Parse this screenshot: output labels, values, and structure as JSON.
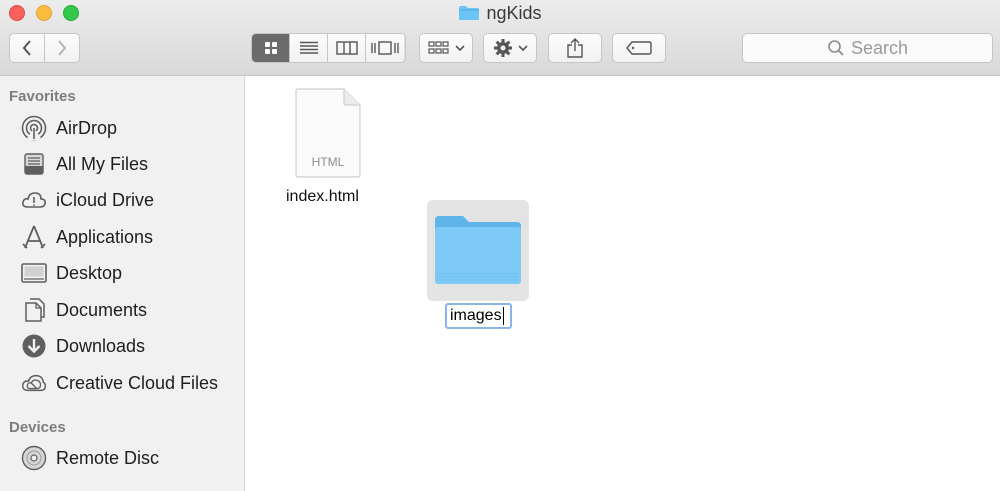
{
  "window": {
    "title": "ngKids"
  },
  "toolbar": {
    "back_icon": "chevron-left-icon",
    "forward_icon": "chevron-right-icon",
    "view_modes": [
      "icon-view-icon",
      "list-view-icon",
      "column-view-icon",
      "cover-flow-icon"
    ],
    "active_view": "icon-view-icon",
    "arrange_icon": "arrange-icon",
    "action_icon": "gear-icon",
    "share_icon": "share-icon",
    "tag_icon": "tag-icon",
    "search_placeholder": "Search"
  },
  "sidebar": {
    "favorites_header": "Favorites",
    "favorites": [
      {
        "label": "AirDrop",
        "icon": "airdrop-icon"
      },
      {
        "label": "All My Files",
        "icon": "all-files-icon"
      },
      {
        "label": "iCloud Drive",
        "icon": "cloud-icon"
      },
      {
        "label": "Applications",
        "icon": "applications-icon"
      },
      {
        "label": "Desktop",
        "icon": "desktop-icon"
      },
      {
        "label": "Documents",
        "icon": "documents-icon"
      },
      {
        "label": "Downloads",
        "icon": "downloads-icon"
      },
      {
        "label": "Creative Cloud Files",
        "icon": "creative-cloud-icon"
      }
    ],
    "devices_header": "Devices",
    "devices": [
      {
        "label": "Remote Disc",
        "icon": "disc-icon"
      }
    ]
  },
  "content": {
    "files": [
      {
        "name": "index.html",
        "type_label": "HTML",
        "icon": "html-file-icon"
      },
      {
        "name": "images",
        "icon": "folder-icon",
        "selected": true,
        "renaming": true
      }
    ]
  },
  "colors": {
    "folder_blue": "#6cc3f5",
    "selection_gray": "#e3e3e3",
    "rename_border": "#8ab4f0"
  }
}
